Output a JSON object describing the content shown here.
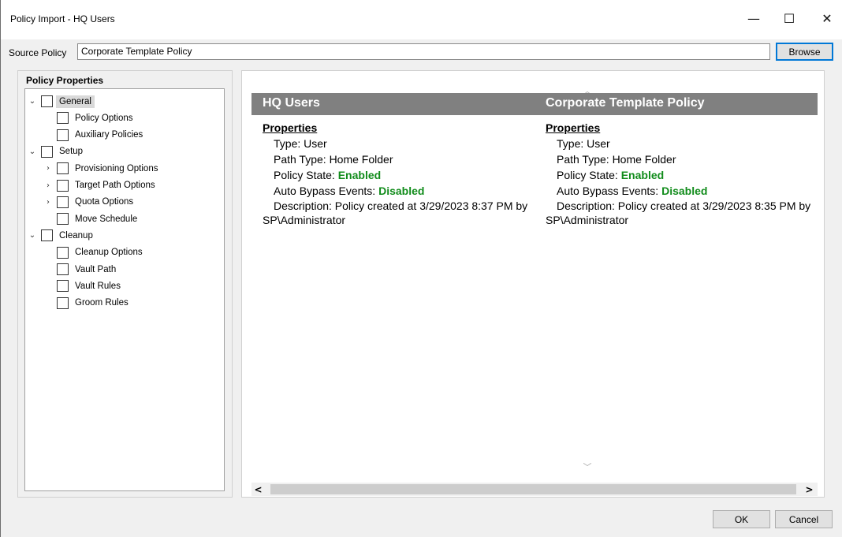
{
  "window": {
    "title": "Policy Import - HQ Users",
    "controls": {
      "minimize": "—",
      "maximize": "☐",
      "close": "✕"
    }
  },
  "source": {
    "label": "Source Policy",
    "value": "Corporate Template Policy",
    "browse_label": "Browse"
  },
  "left_panel": {
    "header": "Policy Properties",
    "tree": [
      {
        "label": "General",
        "expander": "⌄",
        "level": 0,
        "selected": true
      },
      {
        "label": "Policy Options",
        "expander": "",
        "level": 1
      },
      {
        "label": "Auxiliary Policies",
        "expander": "",
        "level": 1
      },
      {
        "label": "Setup",
        "expander": "⌄",
        "level": 0
      },
      {
        "label": "Provisioning Options",
        "expander": "›",
        "level": 1
      },
      {
        "label": "Target Path Options",
        "expander": "›",
        "level": 1
      },
      {
        "label": "Quota Options",
        "expander": "›",
        "level": 1
      },
      {
        "label": "Move Schedule",
        "expander": "",
        "level": 1
      },
      {
        "label": "Cleanup",
        "expander": "⌄",
        "level": 0
      },
      {
        "label": "Cleanup Options",
        "expander": "",
        "level": 1
      },
      {
        "label": "Vault Path",
        "expander": "",
        "level": 1
      },
      {
        "label": "Vault Rules",
        "expander": "",
        "level": 1
      },
      {
        "label": "Groom Rules",
        "expander": "",
        "level": 1
      }
    ]
  },
  "compare": {
    "left": {
      "title": "HQ Users",
      "section": "Properties",
      "type": "Type: User",
      "path_type": "Path Type: Home Folder",
      "policy_state_label": "Policy State:",
      "policy_state_value": "Enabled",
      "bypass_label": "Auto Bypass Events:",
      "bypass_value": "Disabled",
      "description_line1": "Description: Policy created at 3/29/2023 8:37 PM by",
      "description_line2": "SP\\Administrator"
    },
    "right": {
      "title": "Corporate Template Policy",
      "section": "Properties",
      "type": "Type: User",
      "path_type": "Path Type: Home Folder",
      "policy_state_label": "Policy State:",
      "policy_state_value": "Enabled",
      "bypass_label": "Auto Bypass Events:",
      "bypass_value": "Disabled",
      "description_line1": "Description: Policy created at 3/29/2023 8:35 PM by",
      "description_line2": "SP\\Administrator"
    },
    "status_color": "#118c1b",
    "header_color": "#808080"
  },
  "scrollbar": {
    "left_arrow": "<",
    "right_arrow": ">",
    "up_arrow": "︿",
    "down_arrow": "﹀"
  },
  "footer": {
    "ok_label": "OK",
    "cancel_label": "Cancel"
  }
}
